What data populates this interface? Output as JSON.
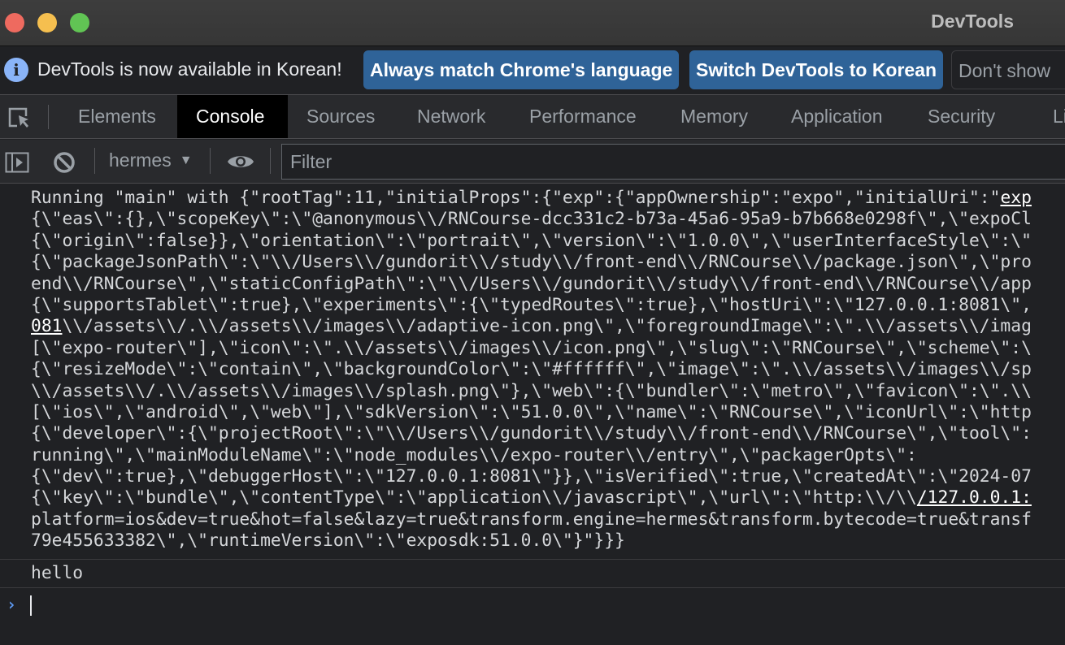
{
  "window": {
    "title": "DevTools",
    "traffic_lights": {
      "close": "#ee6a5f",
      "minimize": "#f5bf4f",
      "maximize": "#61c454"
    }
  },
  "infobar": {
    "icon": "info-icon",
    "message": "DevTools is now available in Korean!",
    "buttons": [
      "Always match Chrome's language",
      "Switch DevTools to Korean",
      "Don't show"
    ],
    "accent": "#2f6398"
  },
  "tabs": {
    "items": [
      "Elements",
      "Console",
      "Sources",
      "Network",
      "Performance",
      "Memory",
      "Application",
      "Security",
      "Lighthouse"
    ],
    "active": "Console"
  },
  "toolbar": {
    "context": "hermes",
    "filter_placeholder": "Filter"
  },
  "console": {
    "messages": [
      {
        "lines": [
          {
            "pre": "Running \"main\" with {\"rootTag\":11,\"initialProps\":{\"exp\":{\"appOwnership\":\"expo\",\"initialUri\":\"",
            "link": "exp",
            "post": ""
          },
          {
            "pre": "{\\\"eas\\\":{},\\\"scopeKey\\\":\\\"@anonymous\\\\/RNCourse-dcc331c2-b73a-45a6-95a9-b7b668e0298f\\\",\\\"expoCl",
            "link": "",
            "post": ""
          },
          {
            "pre": "{\\\"origin\\\":false}},\\\"orientation\\\":\\\"portrait\\\",\\\"version\\\":\\\"1.0.0\\\",\\\"userInterfaceStyle\\\":\\\"",
            "link": "",
            "post": ""
          },
          {
            "pre": "{\\\"packageJsonPath\\\":\\\"\\\\/Users\\\\/gundorit\\\\/study\\\\/front-end\\\\/RNCourse\\\\/package.json\\\",\\\"pro",
            "link": "",
            "post": ""
          },
          {
            "pre": "end\\\\/RNCourse\\\",\\\"staticConfigPath\\\":\\\"\\\\/Users\\\\/gundorit\\\\/study\\\\/front-end\\\\/RNCourse\\\\/app",
            "link": "",
            "post": ""
          },
          {
            "pre": "{\\\"supportsTablet\\\":true},\\\"experiments\\\":{\\\"typedRoutes\\\":true},\\\"hostUri\\\":\\\"127.0.0.1:8081\\\",",
            "link": "",
            "post": ""
          },
          {
            "pre": "",
            "link": "081",
            "post": "\\\\/assets\\\\/.\\\\/assets\\\\/images\\\\/adaptive-icon.png\\\",\\\"foregroundImage\\\":\\\".\\\\/assets\\\\/imag"
          },
          {
            "pre": "[\\\"expo-router\\\"],\\\"icon\\\":\\\".\\\\/assets\\\\/images\\\\/icon.png\\\",\\\"slug\\\":\\\"RNCourse\\\",\\\"scheme\\\":\\",
            "link": "",
            "post": ""
          },
          {
            "pre": "{\\\"resizeMode\\\":\\\"contain\\\",\\\"backgroundColor\\\":\\\"#ffffff\\\",\\\"image\\\":\\\".\\\\/assets\\\\/images\\\\/sp",
            "link": "",
            "post": ""
          },
          {
            "pre": "\\\\/assets\\\\/.\\\\/assets\\\\/images\\\\/splash.png\\\"},\\\"web\\\":{\\\"bundler\\\":\\\"metro\\\",\\\"favicon\\\":\\\".\\\\",
            "link": "",
            "post": ""
          },
          {
            "pre": "[\\\"ios\\\",\\\"android\\\",\\\"web\\\"],\\\"sdkVersion\\\":\\\"51.0.0\\\",\\\"name\\\":\\\"RNCourse\\\",\\\"iconUrl\\\":\\\"http",
            "link": "",
            "post": ""
          },
          {
            "pre": "{\\\"developer\\\":{\\\"projectRoot\\\":\\\"\\\\/Users\\\\/gundorit\\\\/study\\\\/front-end\\\\/RNCourse\\\",\\\"tool\\\":",
            "link": "",
            "post": ""
          },
          {
            "pre": "running\\\",\\\"mainModuleName\\\":\\\"node_modules\\\\/expo-router\\\\/entry\\\",\\\"packagerOpts\\\":",
            "link": "",
            "post": ""
          },
          {
            "pre": "{\\\"dev\\\":true},\\\"debuggerHost\\\":\\\"127.0.0.1:8081\\\"}},\\\"isVerified\\\":true,\\\"createdAt\\\":\\\"2024-07",
            "link": "",
            "post": ""
          },
          {
            "pre": "{\\\"key\\\":\\\"bundle\\\",\\\"contentType\\\":\\\"application\\\\/javascript\\\",\\\"url\\\":\\\"http:\\\\/\\\\",
            "link": "/127.0.0.1:",
            "post": ""
          },
          {
            "pre": "platform=ios&dev=true&hot=false&lazy=true&transform.engine=hermes&transform.bytecode=true&transf",
            "link": "",
            "post": ""
          },
          {
            "pre": "79e455633382\\\",\\\"runtimeVersion\\\":\\\"exposdk:51.0.0\\\"}\"}}}",
            "link": "",
            "post": ""
          }
        ]
      },
      {
        "text": "hello"
      }
    ],
    "prompt_icon": "chevron-right-icon"
  }
}
